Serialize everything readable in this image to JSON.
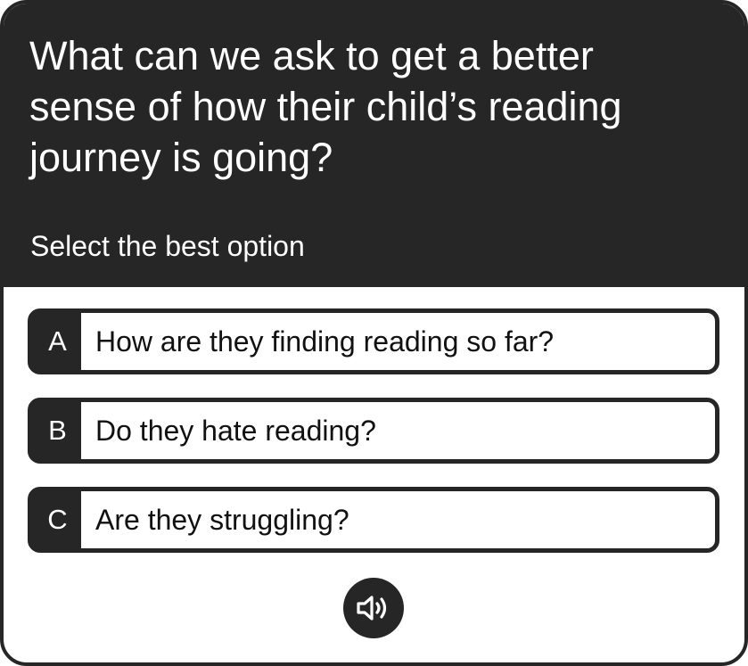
{
  "question": "What can we ask to get a better sense of how their child’s reading journey is going?",
  "instruction": "Select the best option",
  "options": [
    {
      "letter": "A",
      "text": "How are they finding reading so far?"
    },
    {
      "letter": "B",
      "text": "Do they hate reading?"
    },
    {
      "letter": "C",
      "text": "Are they struggling?"
    }
  ],
  "audio_button": {
    "icon": "speaker-icon"
  },
  "colors": {
    "dark": "#262626",
    "light": "#ffffff"
  }
}
